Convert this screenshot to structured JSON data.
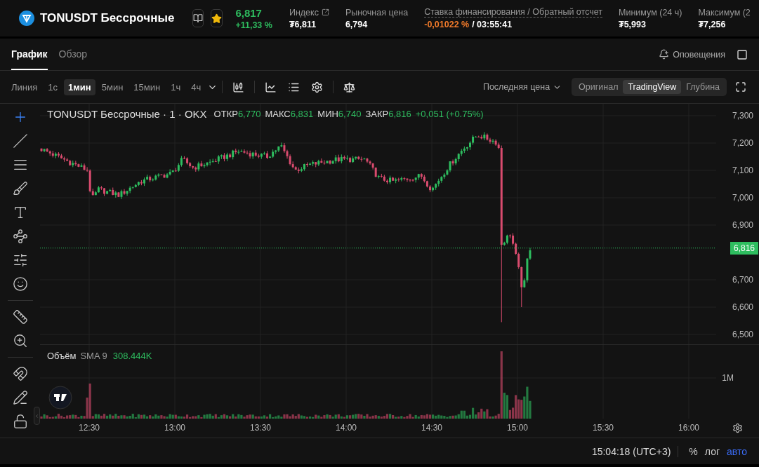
{
  "header": {
    "symbol": "TONUSDT Бессрочные",
    "favorite": true,
    "last_price": "6,817",
    "change": "+11,33 %",
    "stats": [
      {
        "label": "Индекс",
        "value": "₮6,811",
        "kind": "link"
      },
      {
        "label": "Рыночная цена",
        "value": "6,794",
        "kind": "plain"
      },
      {
        "label": "Ставка финансирования / Обратный отсчет",
        "value": "-0,01022 %",
        "value_extra": "/ 03:55:41",
        "kind": "funding"
      },
      {
        "label": "Минимум (24 ч)",
        "value": "₮5,993",
        "kind": "plain"
      },
      {
        "label": "Максимум (2",
        "value": "₮7,256",
        "kind": "plain"
      }
    ]
  },
  "tabs": [
    {
      "label": "График",
      "selected": true
    },
    {
      "label": "Обзор",
      "selected": false
    }
  ],
  "alerts_label": "Оповещения",
  "toolbar": {
    "intervals": [
      {
        "label": "Линия",
        "selected": false
      },
      {
        "label": "1с",
        "selected": false
      },
      {
        "label": "1мин",
        "selected": true
      },
      {
        "label": "5мин",
        "selected": false
      },
      {
        "label": "15мин",
        "selected": false
      },
      {
        "label": "1ч",
        "selected": false
      },
      {
        "label": "4ч",
        "selected": false
      }
    ],
    "price_source": "Последняя цена",
    "views": [
      {
        "label": "Оригинал",
        "selected": false
      },
      {
        "label": "TradingView",
        "selected": true
      },
      {
        "label": "Глубина",
        "selected": false
      }
    ]
  },
  "left_tools": [
    {
      "selected": true
    },
    {
      "selected": false
    },
    {
      "selected": false
    },
    {
      "selected": false
    },
    {
      "selected": false
    },
    {
      "selected": false
    },
    {
      "selected": false
    },
    {
      "selected": false
    },
    {
      "selected": false
    },
    {
      "selected": false
    },
    {
      "selected": false
    },
    {
      "selected": false
    },
    {
      "selected": false
    }
  ],
  "legend": {
    "title": "TONUSDT Бессрочные · 1 · OKX",
    "ohlc": [
      {
        "label": "ОТКР",
        "value": "6,770"
      },
      {
        "label": "МАКС",
        "value": "6,831"
      },
      {
        "label": "МИН",
        "value": "6,740"
      },
      {
        "label": "ЗАКР",
        "value": "6,816"
      }
    ],
    "change": "+0,051 (+0.75%)"
  },
  "price_axis": {
    "ticks": [
      "7,300",
      "7,200",
      "7,100",
      "7,000",
      "6,900",
      "6,700",
      "6,600",
      "6,500"
    ],
    "last_price": "6,816"
  },
  "volume": {
    "label": "Объём",
    "indicator": "SMA 9",
    "value": "308.444K",
    "axis_label": "1M"
  },
  "time_axis": {
    "labels": [
      "12:30",
      "13:00",
      "13:30",
      "14:00",
      "14:30",
      "15:00",
      "15:30",
      "16:00"
    ]
  },
  "status_bar": {
    "time": "15:04:18 (UTC+3)",
    "scale_options": [
      {
        "label": "%",
        "selected": false
      },
      {
        "label": "лог",
        "selected": false
      },
      {
        "label": "авто",
        "selected": true
      }
    ]
  }
}
